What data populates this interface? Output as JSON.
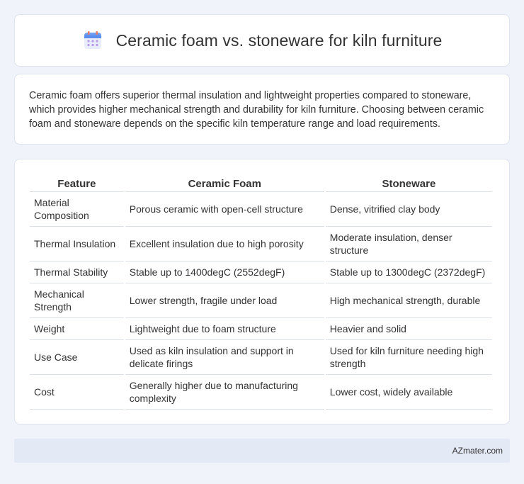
{
  "header": {
    "title": "Ceramic foam vs. stoneware for kiln furniture",
    "icon": "calendar-icon"
  },
  "intro": {
    "text": "Ceramic foam offers superior thermal insulation and lightweight properties compared to stoneware, which provides higher mechanical strength and durability for kiln furniture. Choosing between ceramic foam and stoneware depends on the specific kiln temperature range and load requirements."
  },
  "table": {
    "headers": [
      "Feature",
      "Ceramic Foam",
      "Stoneware"
    ],
    "rows": [
      [
        "Material Composition",
        "Porous ceramic with open-cell structure",
        "Dense, vitrified clay body"
      ],
      [
        "Thermal Insulation",
        "Excellent insulation due to high porosity",
        "Moderate insulation, denser structure"
      ],
      [
        "Thermal Stability",
        "Stable up to 1400degC (2552degF)",
        "Stable up to 1300degC (2372degF)"
      ],
      [
        "Mechanical Strength",
        "Lower strength, fragile under load",
        "High mechanical strength, durable"
      ],
      [
        "Weight",
        "Lightweight due to foam structure",
        "Heavier and solid"
      ],
      [
        "Use Case",
        "Used as kiln insulation and support in delicate firings",
        "Used for kiln furniture needing high strength"
      ],
      [
        "Cost",
        "Generally higher due to manufacturing complexity",
        "Lower cost, widely available"
      ]
    ]
  },
  "footer": {
    "text": "AZmater.com"
  },
  "colors": {
    "background": "#f0f3f9",
    "card": "#ffffff",
    "footer_bg": "#e4e9f6",
    "icon_accent": "#5b8def"
  }
}
